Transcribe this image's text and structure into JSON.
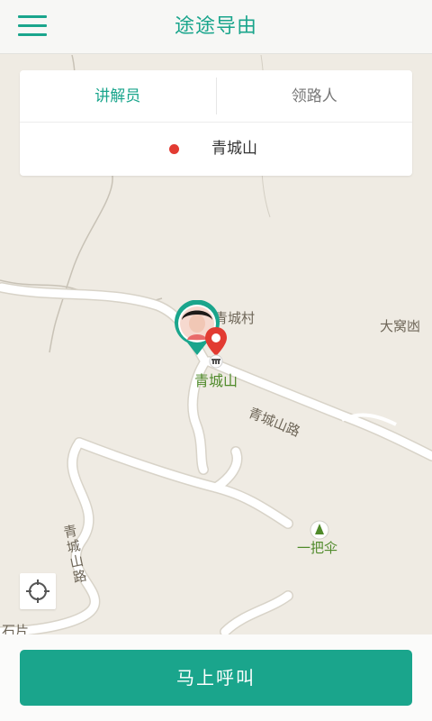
{
  "header": {
    "title": "途途导由",
    "menu_icon": "hamburger-menu-icon"
  },
  "tabs": [
    {
      "label": "讲解员",
      "active": true
    },
    {
      "label": "领路人",
      "active": false
    }
  ],
  "destination": {
    "name": "青城山",
    "dot_color": "#e23b32"
  },
  "map": {
    "labels": {
      "village": "青城村",
      "scenic_spot": "青城山",
      "road_main": "青城山路",
      "road_side": "青城山路",
      "poi_east": "大窝凼",
      "poi_umbrella": "一把伞",
      "poi_sw": "石片"
    }
  },
  "bottom": {
    "call_label": "马上呼叫"
  },
  "colors": {
    "accent": "#1aa58c",
    "marker": "#e23b32",
    "map_bg": "#efebe3"
  }
}
